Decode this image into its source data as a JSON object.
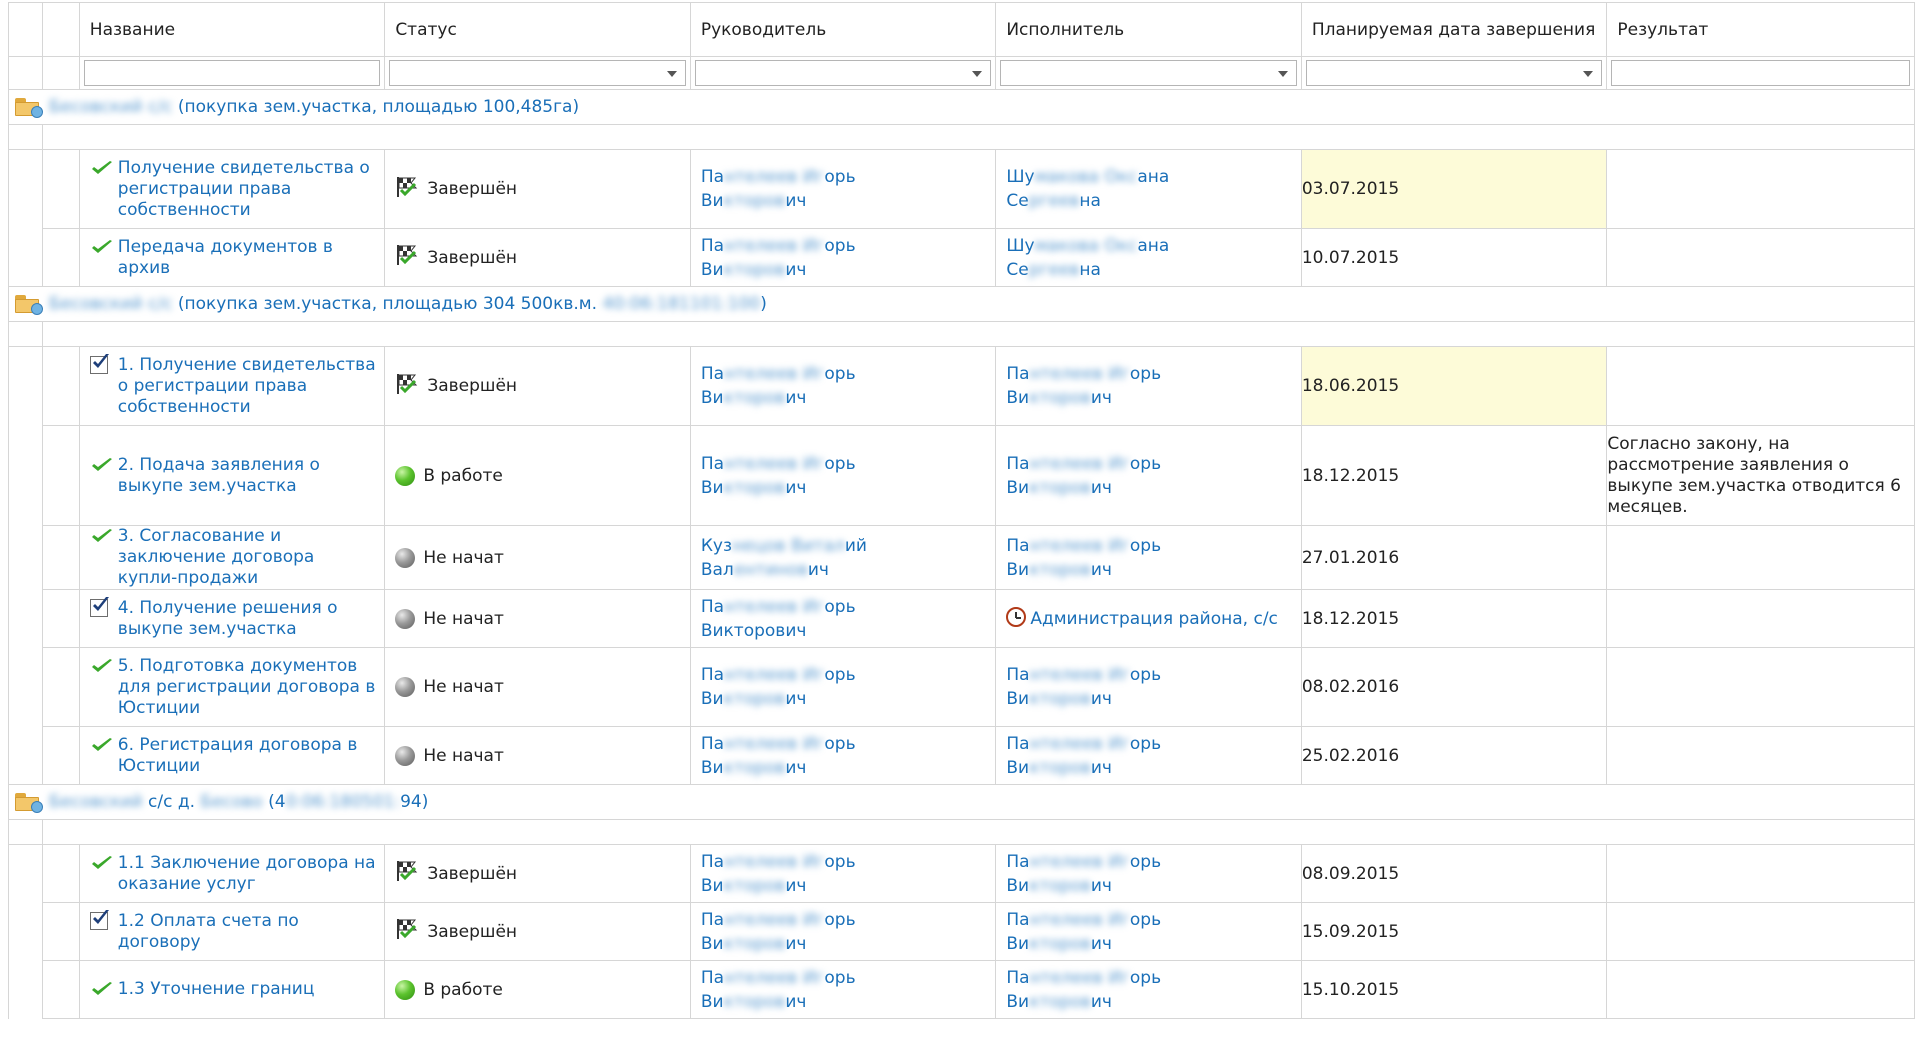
{
  "columns": {
    "name": "Название",
    "status": "Статус",
    "manager": "Руководитель",
    "executor": "Исполнитель",
    "planned_date": "Планируемая дата завершения",
    "result": "Результат"
  },
  "groups": [
    {
      "prefix_blurred": "Бесовский с/с",
      "title": "(покупка зем.участка, площадью 100,485га)",
      "suffix_blurred": "",
      "tasks": [
        {
          "icon": "check-icon",
          "name": "Получение свидетельства о регистрации права собственности",
          "status_icon": "flag-icon",
          "status": "Завершён",
          "manager": [
            "Па",
            "нтелеев Иг",
            "орь",
            "Ви",
            "кторов",
            "ич"
          ],
          "executor": [
            "Шу",
            "макова Окс",
            "ана",
            "Се",
            "ргеев",
            "на"
          ],
          "date": "03.07.2015",
          "highlight": true,
          "result": ""
        },
        {
          "icon": "check-icon",
          "name": "Передача документов в архив",
          "status_icon": "flag-icon",
          "status": "Завершён",
          "manager": [
            "Па",
            "нтелеев Иг",
            "орь",
            "Ви",
            "кторов",
            "ич"
          ],
          "executor": [
            "Шу",
            "макова Окс",
            "ана",
            "Се",
            "ргеев",
            "на"
          ],
          "date": "10.07.2015",
          "highlight": false,
          "result": ""
        }
      ]
    },
    {
      "prefix_blurred": "Бесовский с/с",
      "title": "(покупка зем.участка, площадью 304 500кв.м.",
      "suffix_blurred": "40:06:181101:100",
      "title_end": ")",
      "tasks": [
        {
          "icon": "checkbox-icon",
          "name": "1. Получение свидетельства о регистрации права собственности",
          "status_icon": "flag-icon",
          "status": "Завершён",
          "manager": [
            "Па",
            "нтелеев Иг",
            "орь",
            "Ви",
            "кторов",
            "ич"
          ],
          "executor": [
            "Па",
            "нтелеев Иг",
            "орь",
            "Ви",
            "кторов",
            "ич"
          ],
          "date": "18.06.2015",
          "highlight": true,
          "result": ""
        },
        {
          "icon": "check-icon",
          "name": "2. Подача заявления о выкупе зем.участка",
          "status_icon": "green-ball-icon",
          "status": "В работе",
          "manager": [
            "Па",
            "нтелеев Иг",
            "орь",
            "Ви",
            "кторов",
            "ич"
          ],
          "executor": [
            "Па",
            "нтелеев Иг",
            "орь",
            "Ви",
            "кторов",
            "ич"
          ],
          "date": "18.12.2015",
          "highlight": false,
          "result": "Согласно закону, на рассмотрение заявления о выкупе зем.участка отводится 6 месяцев."
        },
        {
          "icon": "check-icon",
          "name": "3. Согласование и заключение договора купли-продажи",
          "status_icon": "grey-ball-icon",
          "status": "Не начат",
          "manager": [
            "Куз",
            "нецов Витал",
            "ий",
            "Вал",
            "ентинов",
            "ич"
          ],
          "executor": [
            "Па",
            "нтелеев Иг",
            "орь",
            "Ви",
            "кторов",
            "ич"
          ],
          "date": "27.01.2016",
          "highlight": false,
          "result": ""
        },
        {
          "icon": "checkbox-icon",
          "name": "4. Получение решения о выкупе зем.участка",
          "status_icon": "grey-ball-icon",
          "status": "Не начат",
          "manager": [
            "Па",
            "нтелеев Иг",
            "орь",
            "Викторович",
            "",
            ""
          ],
          "executor_special": "Администрация района, с/с",
          "date": "18.12.2015",
          "highlight": false,
          "result": ""
        },
        {
          "icon": "check-icon",
          "name": "5. Подготовка документов для регистрации договора в Юстиции",
          "status_icon": "grey-ball-icon",
          "status": "Не начат",
          "manager": [
            "Па",
            "нтелеев Иг",
            "орь",
            "Ви",
            "кторов",
            "ич"
          ],
          "executor": [
            "Па",
            "нтелеев Иг",
            "орь",
            "Ви",
            "кторов",
            "ич"
          ],
          "date": "08.02.2016",
          "highlight": false,
          "result": ""
        },
        {
          "icon": "check-icon",
          "name": "6. Регистрация договора в Юстиции",
          "status_icon": "grey-ball-icon",
          "status": "Не начат",
          "manager": [
            "Па",
            "нтелеев Иг",
            "орь",
            "Ви",
            "кторов",
            "ич"
          ],
          "executor": [
            "Па",
            "нтелеев Иг",
            "орь",
            "Ви",
            "кторов",
            "ич"
          ],
          "date": "25.02.2016",
          "highlight": false,
          "result": ""
        }
      ]
    },
    {
      "prefix_blurred": "Бесовский",
      "title": "с/с д.",
      "suffix_blurred": "Бесово",
      "title_mid": "(4",
      "suffix2_blurred": "0:06:180501:",
      "title_end": "94)",
      "tasks": [
        {
          "icon": "check-icon",
          "name": "1.1 Заключение договора на оказание услуг",
          "status_icon": "flag-icon",
          "status": "Завершён",
          "manager": [
            "Па",
            "нтелеев Иг",
            "орь",
            "Ви",
            "кторов",
            "ич"
          ],
          "executor": [
            "Па",
            "нтелеев Иг",
            "орь",
            "Ви",
            "кторов",
            "ич"
          ],
          "date": "08.09.2015",
          "highlight": false,
          "result": ""
        },
        {
          "icon": "checkbox-icon",
          "name": "1.2 Оплата счета по договору",
          "status_icon": "flag-icon",
          "status": "Завершён",
          "manager": [
            "Па",
            "нтелеев Иг",
            "орь",
            "Ви",
            "кторов",
            "ич"
          ],
          "executor": [
            "Па",
            "нтелеев Иг",
            "орь",
            "Ви",
            "кторов",
            "ич"
          ],
          "date": "15.09.2015",
          "highlight": false,
          "result": ""
        },
        {
          "icon": "check-icon",
          "name": "1.3 Уточнение границ",
          "status_icon": "green-ball-icon",
          "status": "В работе",
          "manager": [
            "Па",
            "нтелеев Иг",
            "орь",
            "Ви",
            "кторов",
            "ич"
          ],
          "executor": [
            "Па",
            "нтелеев Иг",
            "орь",
            "Ви",
            "кторов",
            "ич"
          ],
          "date": "15.10.2015",
          "highlight": false,
          "result": ""
        }
      ]
    }
  ]
}
